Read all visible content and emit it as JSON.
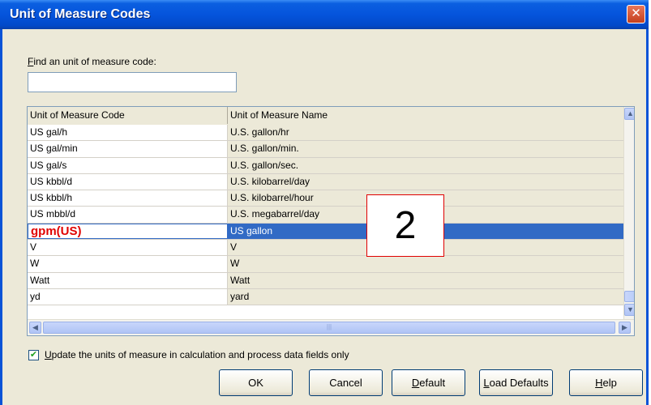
{
  "window": {
    "title": "Unit of Measure Codes",
    "close_glyph": "✕"
  },
  "find": {
    "label_accel": "F",
    "label_rest": "ind an unit of measure code:",
    "value": ""
  },
  "grid": {
    "columns": [
      "Unit of Measure Code",
      "Unit of Measure Name"
    ],
    "rows": [
      {
        "code": "US gal/h",
        "name": "U.S. gallon/hr"
      },
      {
        "code": "US gal/min",
        "name": "U.S. gallon/min."
      },
      {
        "code": "US gal/s",
        "name": "U.S. gallon/sec."
      },
      {
        "code": "US kbbl/d",
        "name": "U.S. kilobarrel/day"
      },
      {
        "code": "US kbbl/h",
        "name": "U.S. kilobarrel/hour"
      },
      {
        "code": "US mbbl/d",
        "name": "U.S. megabarrel/day"
      },
      {
        "code": "gpm(US)",
        "name": "US gallon"
      },
      {
        "code": "V",
        "name": "V"
      },
      {
        "code": "W",
        "name": "W"
      },
      {
        "code": "Watt",
        "name": "Watt"
      },
      {
        "code": "yd",
        "name": "yard"
      }
    ],
    "selected_row_index": 6
  },
  "scroll": {
    "up_glyph": "▲",
    "down_glyph": "▼",
    "left_glyph": "◀",
    "right_glyph": "▶",
    "thumb_grip": "|||"
  },
  "annotation": {
    "text": "2"
  },
  "options": {
    "checkbox_checked": true,
    "checkbox_glyph": "✔",
    "checkbox_label_accel": "U",
    "checkbox_label_rest": "pdate the units of measure in calculation and process data fields only"
  },
  "buttons": {
    "ok": "OK",
    "cancel": "Cancel",
    "default_accel": "D",
    "default_rest": "efault",
    "load_accel": "L",
    "load_rest": "oad Defaults",
    "help_accel": "H",
    "help_rest": "elp"
  },
  "colors": {
    "titlebar": "#0554dc",
    "selection": "#316ac5",
    "annotation_border": "#e00000",
    "selected_code_text": "#e00000"
  }
}
